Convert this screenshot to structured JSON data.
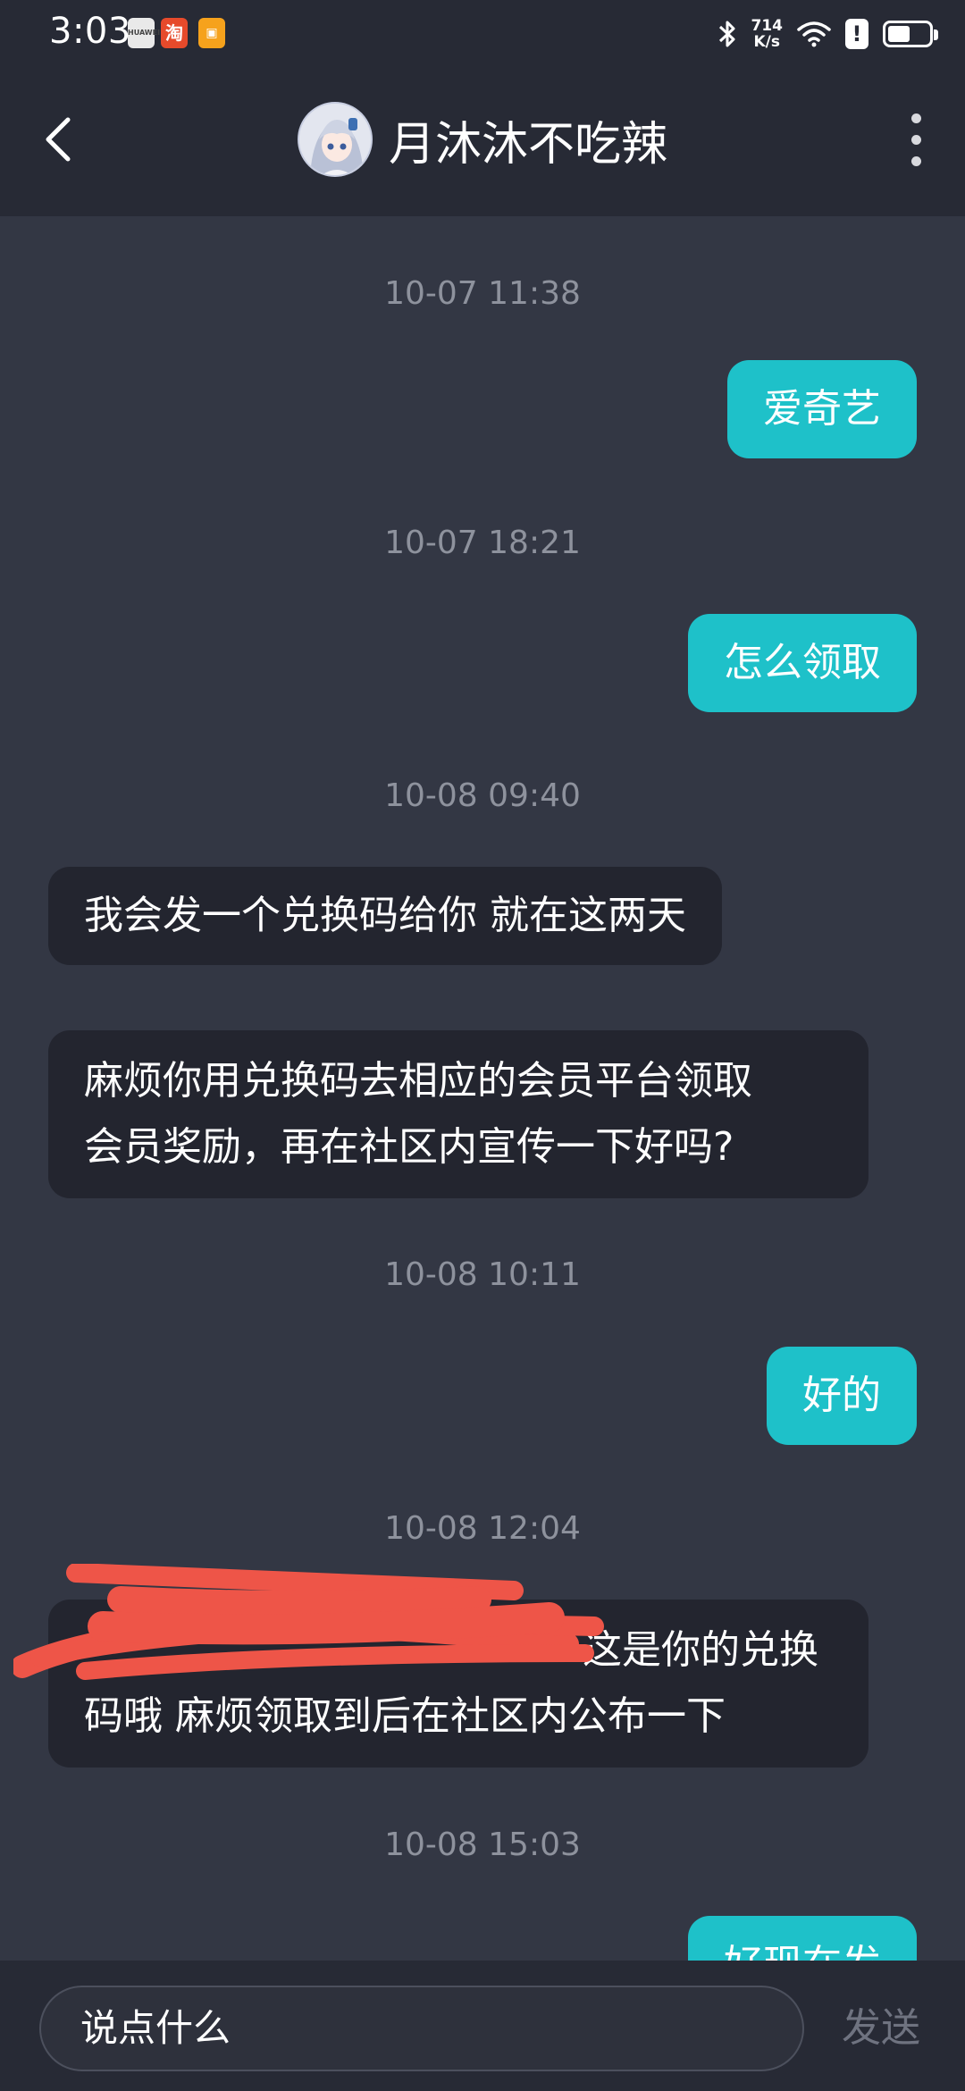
{
  "status_bar": {
    "time": "3:03",
    "app_a": "HUAWEI",
    "app_b": "淘",
    "app_c": "▣",
    "net_speed_value": "714",
    "net_speed_unit": "K/s",
    "battery_level_percent": 55,
    "icons": [
      "bluetooth-icon",
      "wifi-icon",
      "alert-icon",
      "battery-icon"
    ]
  },
  "header": {
    "title": "月沐沐不吃辣",
    "back_icon": "chevron-left-icon",
    "more_icon": "more-vertical-icon"
  },
  "messages": [
    {
      "type": "timestamp",
      "text": "10-07 11:38"
    },
    {
      "type": "outgoing",
      "text": "爱奇艺"
    },
    {
      "type": "timestamp",
      "text": "10-07 18:21"
    },
    {
      "type": "outgoing",
      "text": "怎么领取"
    },
    {
      "type": "timestamp",
      "text": "10-08 09:40"
    },
    {
      "type": "incoming",
      "text": "我会发一个兑换码给你 就在这两天"
    },
    {
      "type": "incoming",
      "lines": [
        "麻烦你用兑换码去相应的会员平台领取",
        "会员奖励，再在社区内宣传一下好吗?"
      ]
    },
    {
      "type": "timestamp",
      "text": "10-08 10:11"
    },
    {
      "type": "outgoing",
      "text": "好的"
    },
    {
      "type": "timestamp",
      "text": "10-08 12:04"
    },
    {
      "type": "incoming",
      "lines": [
        "这是你的兑换",
        "码哦 麻烦领取到后在社区内公布一下"
      ],
      "redacted": true
    },
    {
      "type": "timestamp",
      "text": "10-08 15:03"
    },
    {
      "type": "outgoing",
      "text": "好现在发"
    }
  ],
  "composer": {
    "placeholder": "说点什么",
    "send_label": "发送"
  },
  "colors": {
    "background": "#333744",
    "bar": "#272a35",
    "outgoing_bubble": "#1ec1c9",
    "incoming_bubble": "#23252f",
    "timestamp": "#8e929d",
    "redaction": "#ee5548"
  }
}
